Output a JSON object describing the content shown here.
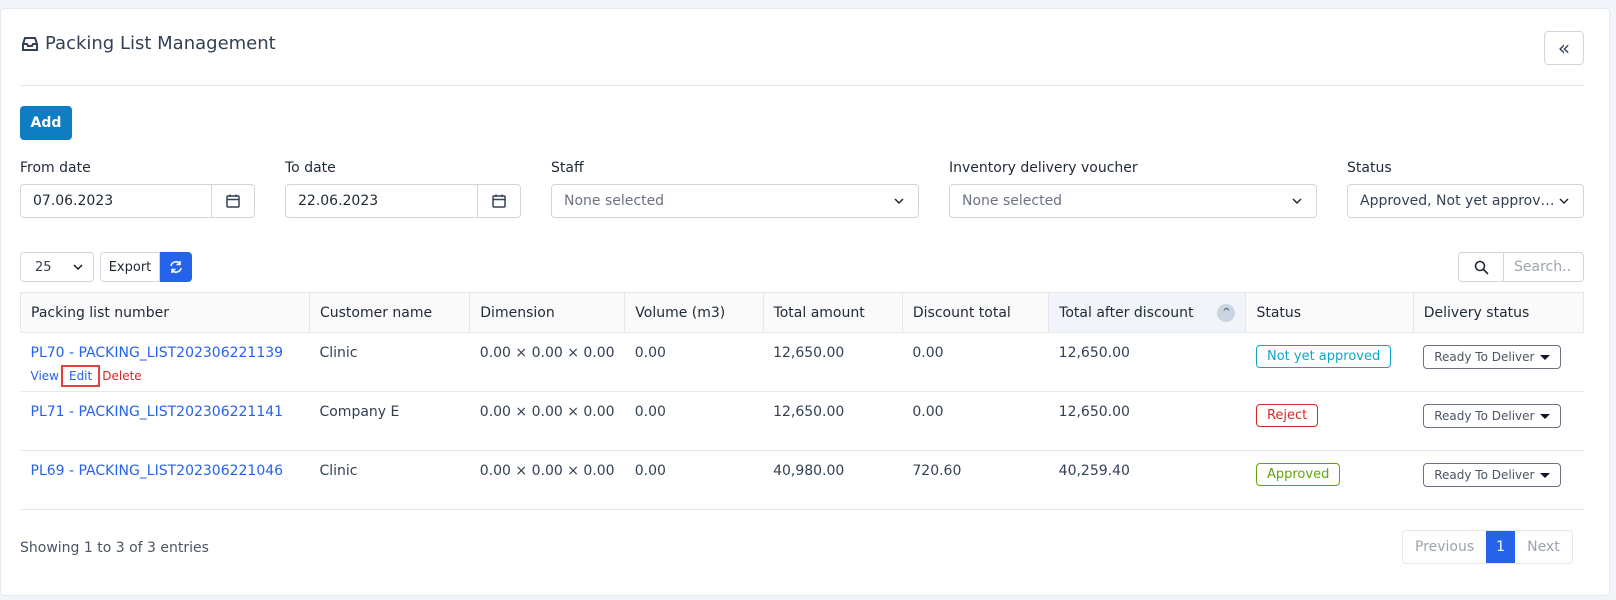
{
  "header": {
    "title": "Packing List Management",
    "icon": "inbox-icon",
    "collapse_icon": "double-chevron-left-icon"
  },
  "toolbar": {
    "add_label": "Add"
  },
  "filters": {
    "from_date": {
      "label": "From date",
      "value": "07.06.2023"
    },
    "to_date": {
      "label": "To date",
      "value": "22.06.2023"
    },
    "staff": {
      "label": "Staff",
      "value": "None selected"
    },
    "voucher": {
      "label": "Inventory delivery voucher",
      "value": "None selected"
    },
    "status": {
      "label": "Status",
      "value": "Approved, Not yet approved,..."
    }
  },
  "table_controls": {
    "page_length": "25",
    "export_label": "Export",
    "search_placeholder": "Search.."
  },
  "table": {
    "headers": [
      "Packing list number",
      "Customer name",
      "Dimension",
      "Volume (m3)",
      "Total amount",
      "Discount total",
      "Total after discount",
      "Status",
      "Delivery status"
    ],
    "row_actions": {
      "view": "View",
      "edit": "Edit",
      "delete": "Delete"
    },
    "rows": [
      {
        "number": "PL70 - PACKING_LIST202306221139",
        "customer": "Clinic",
        "dimension": "0.00 × 0.00 × 0.00",
        "volume": "0.00",
        "total": "12,650.00",
        "discount": "0.00",
        "after_discount": "12,650.00",
        "status": "Not yet approved",
        "delivery": "Ready To Deliver"
      },
      {
        "number": "PL71 - PACKING_LIST202306221141",
        "customer": "Company E",
        "dimension": "0.00 × 0.00 × 0.00",
        "volume": "0.00",
        "total": "12,650.00",
        "discount": "0.00",
        "after_discount": "12,650.00",
        "status": "Reject",
        "delivery": "Ready To Deliver"
      },
      {
        "number": "PL69 - PACKING_LIST202306221046",
        "customer": "Clinic",
        "dimension": "0.00 × 0.00 × 0.00",
        "volume": "0.00",
        "total": "40,980.00",
        "discount": "720.60",
        "after_discount": "40,259.40",
        "status": "Approved",
        "delivery": "Ready To Deliver"
      }
    ]
  },
  "status_colors": {
    "Not yet approved": "#0ea5c6",
    "Reject": "#dc2626",
    "Approved": "#65a30d"
  },
  "footer": {
    "info": "Showing 1 to 3 of 3 entries",
    "previous": "Previous",
    "page": "1",
    "next": "Next"
  }
}
